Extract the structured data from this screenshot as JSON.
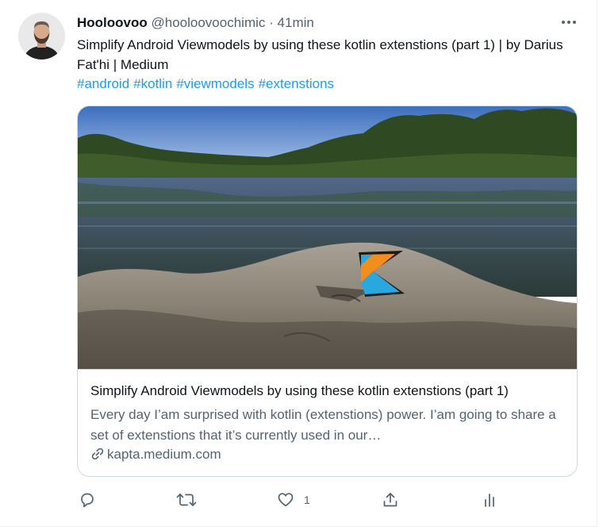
{
  "tweet": {
    "display_name": "Hooloovoo",
    "handle": "@hooloovoochimic",
    "separator": "·",
    "timestamp": "41min",
    "text": "Simplify Android Viewmodels by using these kotlin extenstions (part 1) | by Darius Fat'hi | Medium",
    "hashtags": [
      "#android",
      "#kotlin",
      "#viewmodels",
      "#extenstions"
    ]
  },
  "card": {
    "title": "Simplify Android Viewmodels by using these kotlin extenstions (part 1)",
    "description": "Every day I’am surprised with kotlin (extenstions) power. I’am going to share a set of extenstions that it’s currently used in our…",
    "domain": "kapta.medium.com",
    "image_subject": "Kotlin logo pin on a rock beside a lake"
  },
  "actions": {
    "reply_icon": "reply-icon",
    "retweet_icon": "retweet-icon",
    "like_icon": "heart-icon",
    "like_count": "1",
    "share_icon": "share-icon",
    "analytics_icon": "analytics-icon"
  },
  "colors": {
    "text": "#0f1419",
    "secondary": "#536471",
    "link": "#1d9bf0",
    "border": "#cfd9de",
    "kotlin_orange": "#f18e1c",
    "kotlin_blue": "#29a8e0"
  }
}
